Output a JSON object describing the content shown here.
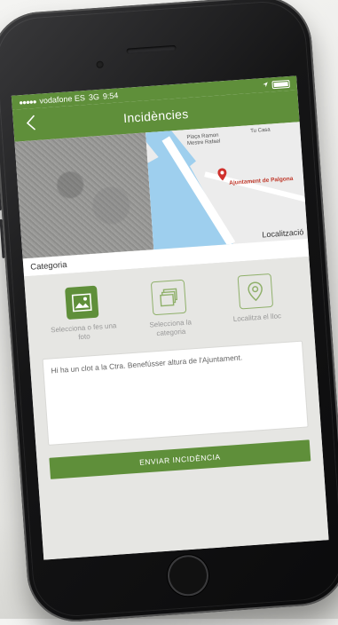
{
  "status_bar": {
    "signal": "●●●●●",
    "carrier": "vodafone ES",
    "network": "3G",
    "time": "9:54"
  },
  "nav": {
    "title": "Incidències"
  },
  "map": {
    "labels": [
      "Plaça Ramon",
      "Mestre Rafael",
      "Tu Casa"
    ],
    "place_name": "Ajuntament de Palgona",
    "localization_label": "Localització"
  },
  "category": {
    "label": "Categoria"
  },
  "actions": [
    {
      "label": "Selecciona o fes una foto",
      "icon": "image-icon"
    },
    {
      "label": "Selecciona la categoria",
      "icon": "stack-icon"
    },
    {
      "label": "Localitza el lloc",
      "icon": "location-pin-icon"
    }
  ],
  "description": {
    "text": "Hi ha un clot a la Ctra. Benefússer altura de l'Ajuntament."
  },
  "send_button": {
    "label": "ENVIAR INCIDÈNCIA"
  },
  "colors": {
    "brand_green": "#5f8f3a",
    "screen_bg": "#e6e6e3"
  }
}
